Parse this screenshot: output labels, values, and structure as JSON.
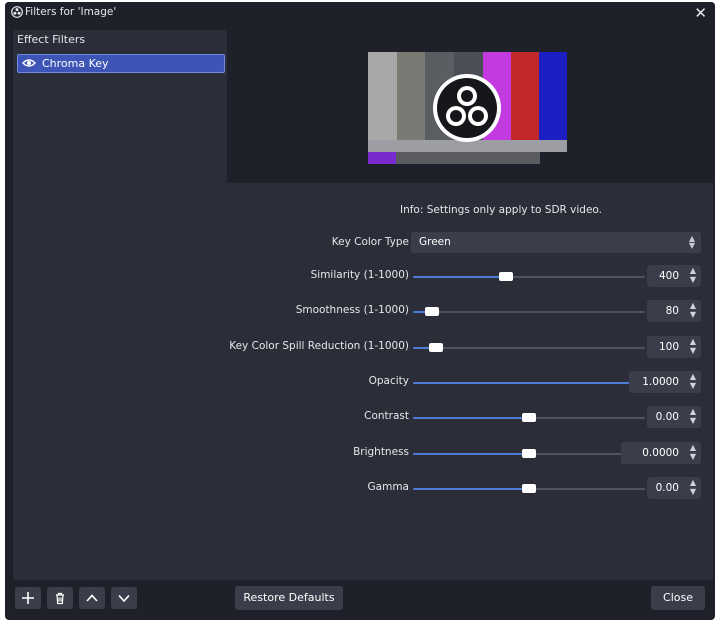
{
  "window": {
    "title": "Filters for 'Image'"
  },
  "left_panel": {
    "heading": "Effect Filters",
    "filters": [
      {
        "label": "Chroma Key",
        "visible": true
      }
    ]
  },
  "toolbar": [
    "add-icon",
    "trash-icon",
    "chevron-up-icon",
    "chevron-down-icon"
  ],
  "info": "Info: Settings only apply to SDR video.",
  "key_color_type": {
    "label": "Key Color Type",
    "value": "Green"
  },
  "settings": [
    {
      "label": "Similarity (1-1000)",
      "value": "400",
      "fraction": 0.4
    },
    {
      "label": "Smoothness (1-1000)",
      "value": "80",
      "fraction": 0.08
    },
    {
      "label": "Key Color Spill Reduction (1-1000)",
      "value": "100",
      "fraction": 0.1
    },
    {
      "label": "Opacity",
      "value": "1.0000",
      "fraction": 1.0
    },
    {
      "label": "Contrast",
      "value": "0.00",
      "fraction": 0.5
    },
    {
      "label": "Brightness",
      "value": "0.0000",
      "fraction": 0.5
    },
    {
      "label": "Gamma",
      "value": "0.00",
      "fraction": 0.5
    }
  ],
  "buttons": {
    "restore": "Restore Defaults",
    "close": "Close"
  },
  "colors": {
    "accent": "#4b7dd8",
    "selection": "#3c55b7",
    "background": "#1f212a",
    "panel": "#2b2e38"
  }
}
